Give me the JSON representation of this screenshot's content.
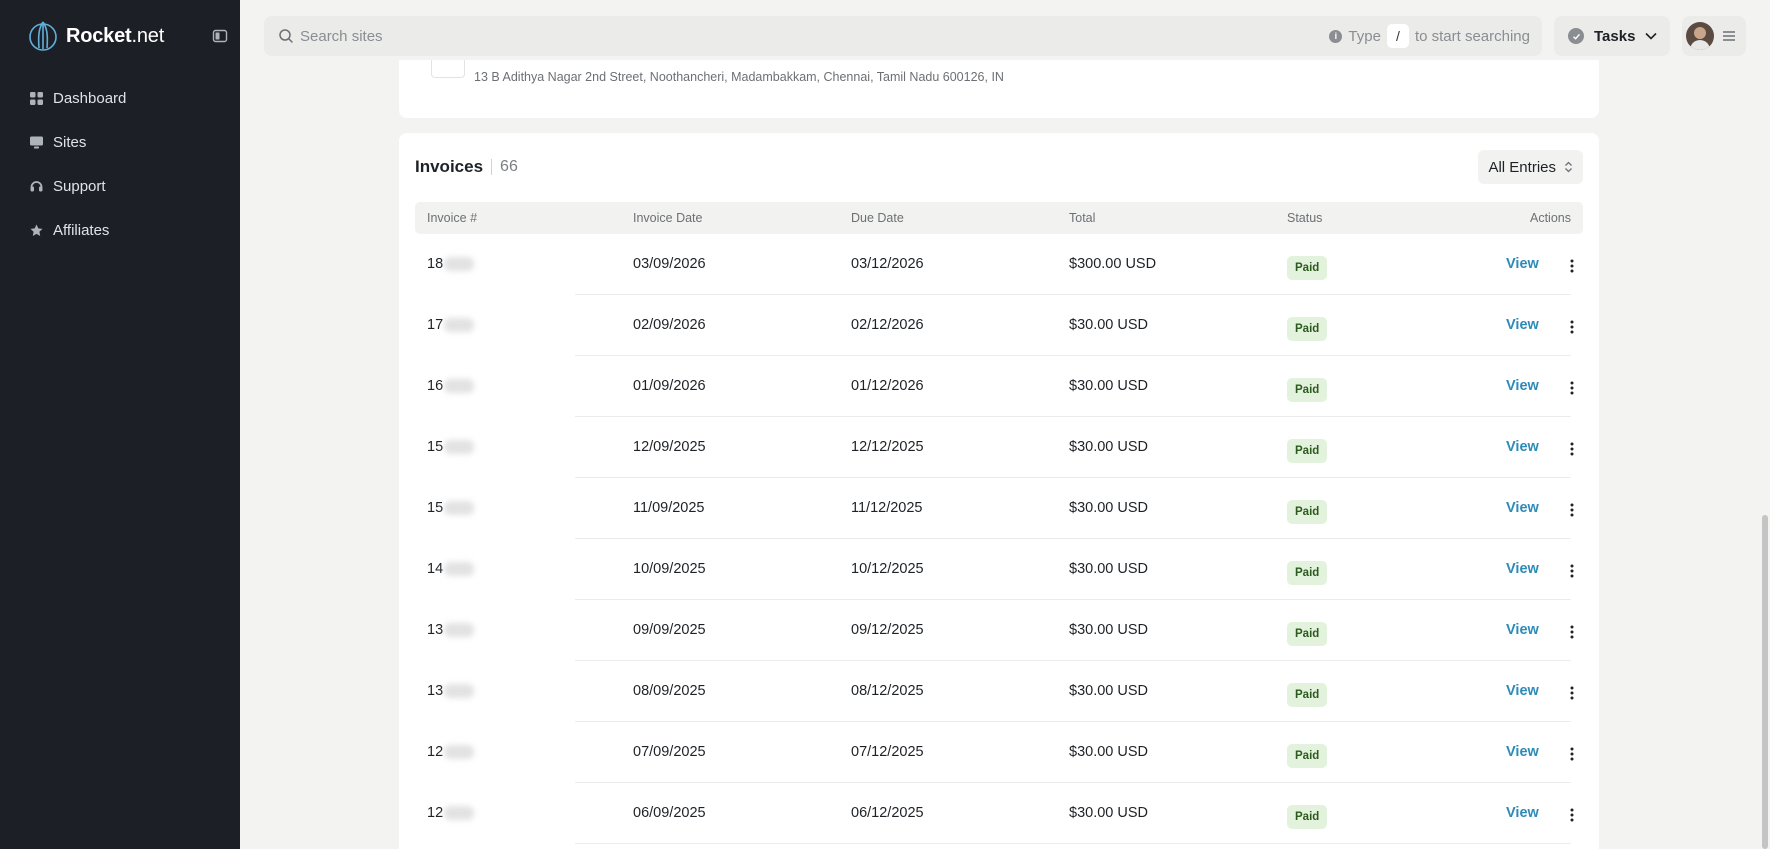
{
  "brand": {
    "name_bold": "Rocket",
    "name_light": ".net"
  },
  "sidebar": {
    "items": [
      {
        "label": "Dashboard",
        "icon": "grid-icon"
      },
      {
        "label": "Sites",
        "icon": "monitor-icon"
      },
      {
        "label": "Support",
        "icon": "headset-icon"
      },
      {
        "label": "Affiliates",
        "icon": "star-icon"
      }
    ]
  },
  "header": {
    "search_placeholder": "Search sites",
    "hint_prefix": "Type",
    "hint_key": "/",
    "hint_suffix": "to start searching",
    "tasks_label": "Tasks"
  },
  "address": {
    "text": "13 B Adithya Nagar 2nd Street, Noothancheri, Madambakkam, Chennai, Tamil Nadu 600126, IN"
  },
  "invoices": {
    "title": "Invoices",
    "count": "66",
    "filter_label": "All Entries",
    "columns": {
      "number": "Invoice #",
      "invoice_date": "Invoice Date",
      "due_date": "Due Date",
      "total": "Total",
      "status": "Status",
      "actions": "Actions"
    },
    "view_label": "View",
    "rows": [
      {
        "number": "18",
        "invoice_date": "03/09/2026",
        "due_date": "03/12/2026",
        "total": "$300.00 USD",
        "status": "Paid"
      },
      {
        "number": "17",
        "invoice_date": "02/09/2026",
        "due_date": "02/12/2026",
        "total": "$30.00 USD",
        "status": "Paid"
      },
      {
        "number": "16",
        "invoice_date": "01/09/2026",
        "due_date": "01/12/2026",
        "total": "$30.00 USD",
        "status": "Paid"
      },
      {
        "number": "15",
        "invoice_date": "12/09/2025",
        "due_date": "12/12/2025",
        "total": "$30.00 USD",
        "status": "Paid"
      },
      {
        "number": "15",
        "invoice_date": "11/09/2025",
        "due_date": "11/12/2025",
        "total": "$30.00 USD",
        "status": "Paid"
      },
      {
        "number": "14",
        "invoice_date": "10/09/2025",
        "due_date": "10/12/2025",
        "total": "$30.00 USD",
        "status": "Paid"
      },
      {
        "number": "13",
        "invoice_date": "09/09/2025",
        "due_date": "09/12/2025",
        "total": "$30.00 USD",
        "status": "Paid"
      },
      {
        "number": "13",
        "invoice_date": "08/09/2025",
        "due_date": "08/12/2025",
        "total": "$30.00 USD",
        "status": "Paid"
      },
      {
        "number": "12",
        "invoice_date": "07/09/2025",
        "due_date": "07/12/2025",
        "total": "$30.00 USD",
        "status": "Paid"
      },
      {
        "number": "12",
        "invoice_date": "06/09/2025",
        "due_date": "06/12/2025",
        "total": "$30.00 USD",
        "status": "Paid"
      }
    ]
  },
  "colors": {
    "sidebar_bg": "#1c2026",
    "link": "#2d8bb8",
    "paid_badge_bg": "#e3f2dc",
    "paid_badge_text": "#2d5a1e"
  }
}
